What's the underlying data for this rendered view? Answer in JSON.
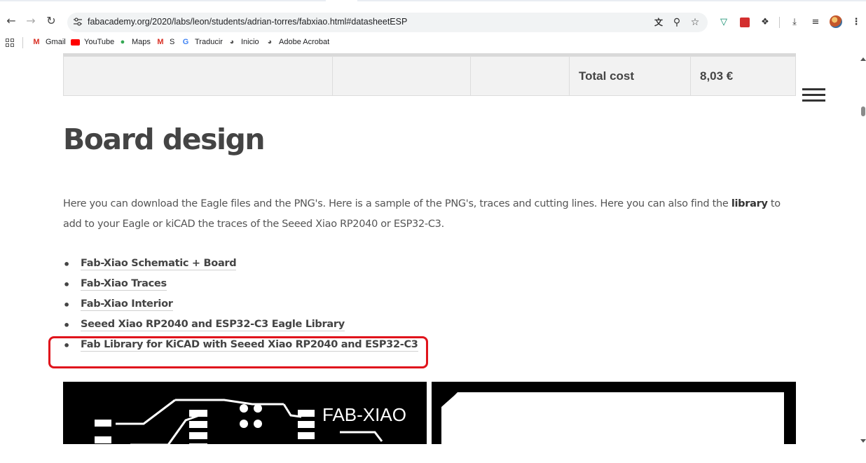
{
  "browser": {
    "url": "fabacademy.org/2020/labs/leon/students/adrian-torres/fabxiao.html#datasheetESP",
    "icons": {
      "back": "back-arrow-icon",
      "forward": "forward-arrow-icon",
      "reload": "reload-icon",
      "site_info": "tune-icon",
      "translate": "translate-icon",
      "zoom": "zoom-icon",
      "bookmark": "star-icon",
      "extension1": "shield-extension-icon",
      "extension2": "red-extension-icon",
      "extensions": "puzzle-icon",
      "download": "download-icon",
      "reading_list": "playlist-icon",
      "profile": "avatar",
      "menu": "kebab-menu-icon"
    }
  },
  "bookmarks": [
    {
      "label": "Gmail",
      "icon": "gmail-icon",
      "color": "#d93025"
    },
    {
      "label": "YouTube",
      "icon": "youtube-icon",
      "color": "#ff0000"
    },
    {
      "label": "Maps",
      "icon": "maps-pin-icon",
      "color": "#34a853"
    },
    {
      "label": "S",
      "icon": "gmail-icon",
      "color": "#d93025"
    },
    {
      "label": "Traducir",
      "icon": "translate-icon",
      "color": "#4285f4"
    },
    {
      "label": "Inicio",
      "icon": "globe-icon",
      "color": "#555555"
    },
    {
      "label": "Adobe Acrobat",
      "icon": "globe-icon",
      "color": "#555555"
    }
  ],
  "table": {
    "total_label": "Total cost",
    "total_value": "8,03 €"
  },
  "page": {
    "heading": "Board design",
    "paragraph_before_bold": "Here you can download the Eagle files and the PNG's. Here is a sample of the PNG's, traces and cutting lines. Here you can also find the ",
    "paragraph_bold": "library",
    "paragraph_after_bold": " to add to your Eagle or kiCAD the traces of the Seeed Xiao RP2040 or ESP32-C3.",
    "links": [
      "Fab-Xiao Schematic + Board",
      "Fab-Xiao Traces",
      "Fab-Xiao Interior",
      "Seeed Xiao RP2040 and ESP32-C3 Eagle Library",
      "Fab Library for KiCAD with Seeed Xiao RP2040 and ESP32-C3"
    ],
    "image_label": "FAB-XIAO"
  },
  "colors": {
    "highlight": "#e0141c",
    "text": "#444444"
  }
}
